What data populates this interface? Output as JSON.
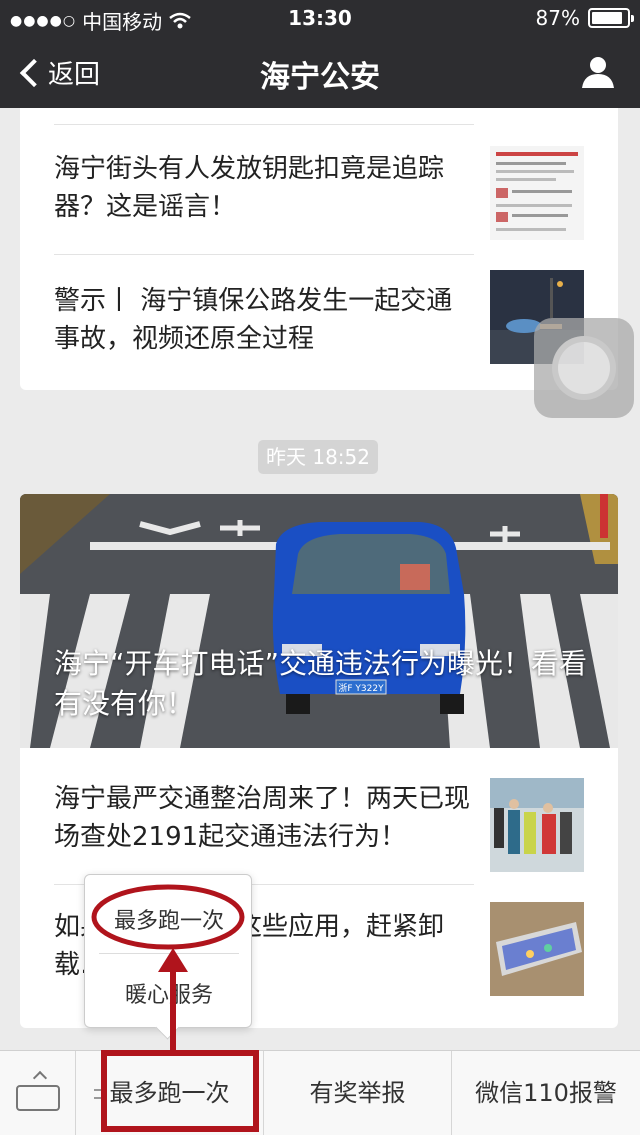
{
  "status_bar": {
    "signal": "●●●●○",
    "carrier": "中国移动",
    "time": "13:30",
    "battery": "87%",
    "battery_level": 0.87
  },
  "nav": {
    "back_label": "返回",
    "title": "海宁公安"
  },
  "articles_top": [
    {
      "title": "海宁街头有人发放钥匙扣竟是追踪器？这是谣言！"
    },
    {
      "title": "警示丨 海宁镇保公路发生一起交通事故，视频还原全过程"
    }
  ],
  "time_badge": "昨天 18:52",
  "hero": {
    "title": "海宁“开车打电话”交通违法行为曝光！看看有没有你！",
    "plate": "浙F Y322Y"
  },
  "articles_bottom": [
    {
      "title": "海宁最严交通整治周来了！两天已现场查处2191起交通违法行为！"
    },
    {
      "title": "如果你手机里有这些应用，赶紧卸载…"
    }
  ],
  "popup_menu": {
    "items": [
      "最多跑一次",
      "暖心服务"
    ]
  },
  "bottom_menu": {
    "items": [
      "最多跑一次",
      "有奖举报",
      "微信110报警"
    ]
  },
  "colors": {
    "nav_bg": "#2d2d30",
    "annotation_red": "#b0141c",
    "car_blue": "#1a4fc4"
  }
}
